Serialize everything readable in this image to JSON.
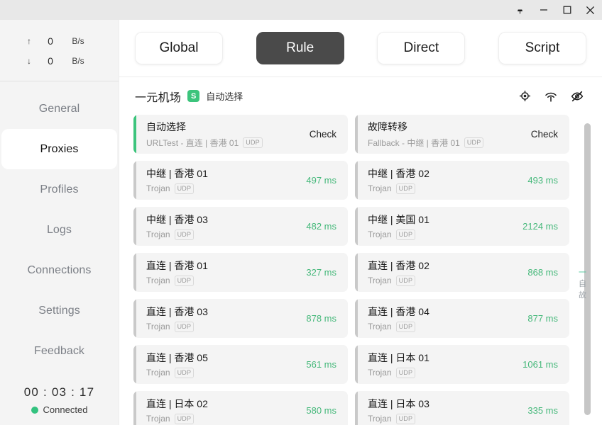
{
  "titlebar": {
    "buttons": [
      {
        "name": "pin-icon",
        "label": "Pin"
      },
      {
        "name": "minimize-icon",
        "label": "Minimize"
      },
      {
        "name": "maximize-icon",
        "label": "Maximize"
      },
      {
        "name": "close-icon",
        "label": "Close"
      }
    ]
  },
  "sidebar": {
    "traffic": {
      "upload": {
        "arrow": "↑",
        "value": "0",
        "unit": "B/s"
      },
      "download": {
        "arrow": "↓",
        "value": "0",
        "unit": "B/s"
      }
    },
    "items": [
      {
        "label": "General",
        "active": false
      },
      {
        "label": "Proxies",
        "active": true
      },
      {
        "label": "Profiles",
        "active": false
      },
      {
        "label": "Logs",
        "active": false
      },
      {
        "label": "Connections",
        "active": false
      },
      {
        "label": "Settings",
        "active": false
      },
      {
        "label": "Feedback",
        "active": false
      }
    ],
    "status": {
      "clock": "00 : 03 : 17",
      "connection_label": "Connected",
      "connection_color": "#33c27f"
    }
  },
  "modes": {
    "buttons": [
      {
        "label": "Global",
        "active": false
      },
      {
        "label": "Rule",
        "active": true
      },
      {
        "label": "Direct",
        "active": false
      },
      {
        "label": "Script",
        "active": false
      }
    ],
    "active_color": "#4a4a4a"
  },
  "group": {
    "title": "一元机场",
    "badge": "S",
    "badge_color": "#3cc47c",
    "subtitle": "自动选择",
    "icons": [
      {
        "name": "locate-icon",
        "label": "Locate current"
      },
      {
        "name": "speedtest-icon",
        "label": "Speed test"
      },
      {
        "name": "eye-off-icon",
        "label": "Hide unavailable"
      }
    ]
  },
  "proxies": [
    {
      "name": "自动选择",
      "meta": "URLTest - 直连 | 香港 01",
      "udp": "UDP",
      "right": "Check",
      "kind": "check",
      "selected": true
    },
    {
      "name": "故障转移",
      "meta": "Fallback - 中继 | 香港 01",
      "udp": "UDP",
      "right": "Check",
      "kind": "check",
      "selected": false
    },
    {
      "name": "中继 | 香港 01",
      "meta": "Trojan",
      "udp": "UDP",
      "right": "497 ms",
      "kind": "latency",
      "selected": false
    },
    {
      "name": "中继 | 香港 02",
      "meta": "Trojan",
      "udp": "UDP",
      "right": "493 ms",
      "kind": "latency",
      "selected": false
    },
    {
      "name": "中继 | 香港 03",
      "meta": "Trojan",
      "udp": "UDP",
      "right": "482 ms",
      "kind": "latency",
      "selected": false
    },
    {
      "name": "中继 | 美国 01",
      "meta": "Trojan",
      "udp": "UDP",
      "right": "2124 ms",
      "kind": "latency",
      "selected": false
    },
    {
      "name": "直连 | 香港 01",
      "meta": "Trojan",
      "udp": "UDP",
      "right": "327 ms",
      "kind": "latency",
      "selected": false
    },
    {
      "name": "直连 | 香港 02",
      "meta": "Trojan",
      "udp": "UDP",
      "right": "868 ms",
      "kind": "latency",
      "selected": false
    },
    {
      "name": "直连 | 香港 03",
      "meta": "Trojan",
      "udp": "UDP",
      "right": "878 ms",
      "kind": "latency",
      "selected": false
    },
    {
      "name": "直连 | 香港 04",
      "meta": "Trojan",
      "udp": "UDP",
      "right": "877 ms",
      "kind": "latency",
      "selected": false
    },
    {
      "name": "直连 | 香港 05",
      "meta": "Trojan",
      "udp": "UDP",
      "right": "561 ms",
      "kind": "latency",
      "selected": false
    },
    {
      "name": "直连 | 日本 01",
      "meta": "Trojan",
      "udp": "UDP",
      "right": "1061 ms",
      "kind": "latency",
      "selected": false
    },
    {
      "name": "直连 | 日本 02",
      "meta": "Trojan",
      "udp": "UDP",
      "right": "580 ms",
      "kind": "latency",
      "selected": false
    },
    {
      "name": "直连 | 日本 03",
      "meta": "Trojan",
      "udp": "UDP",
      "right": "335 ms",
      "kind": "latency",
      "selected": false
    }
  ],
  "minimap": [
    {
      "label": "一",
      "active": true
    },
    {
      "label": "自",
      "active": false
    },
    {
      "label": "故",
      "active": false
    }
  ],
  "colors": {
    "accent_green": "#3cc47c",
    "latency_green": "#45b87a",
    "card_bg": "#f4f4f4",
    "sidebar_bg": "#f4f4f4"
  }
}
